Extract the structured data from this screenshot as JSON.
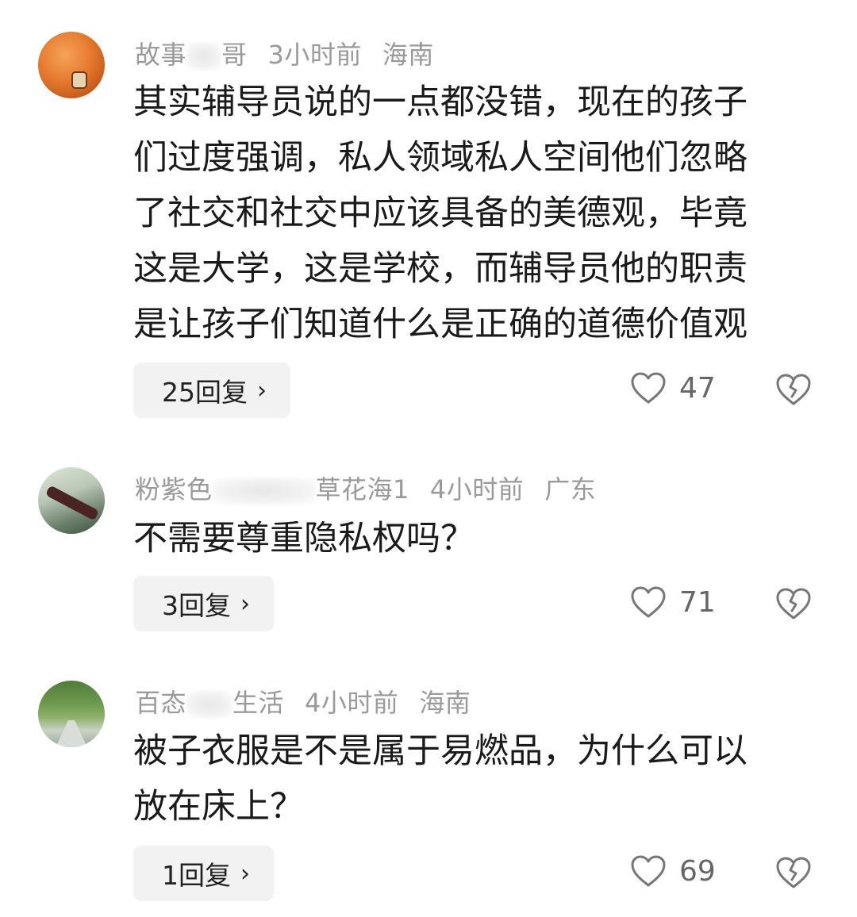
{
  "comments": [
    {
      "username_start": "故事",
      "username_end": "哥",
      "time": "3小时前",
      "location": "海南",
      "text": "其实辅导员说的一点都没错，现在的孩子们过度强调，私人领域私人空间他们忽略了社交和社交中应该具备的美德观，毕竟这是大学，这是学校，而辅导员他的职责是让孩子们知道什么是正确的道德价值观",
      "lines": [
        "其实辅导员说的一点都没错，现在的孩子",
        "们过度强调，私人领域私人空间他们忽略",
        "了社交和社交中应该具备的美德观，毕竟",
        "这是大学，这是学校，而辅导员他的职责",
        "是让孩子们知道什么是正确的道德价值观"
      ],
      "reply_label": "25回复",
      "likes": "47"
    },
    {
      "username_start": "粉紫色",
      "username_end": "草花海1",
      "time": "4小时前",
      "location": "广东",
      "lines": [
        "不需要尊重隐私权吗？"
      ],
      "reply_label": "3回复",
      "likes": "71"
    },
    {
      "username_start": "百态",
      "username_end": "生活",
      "time": "4小时前",
      "location": "海南",
      "lines": [
        "被子衣服是不是属于易燃品，为什么可以",
        "放在床上？"
      ],
      "reply_label": "1回复",
      "likes": "69"
    }
  ],
  "icons": {
    "reply_chevron": "chevron-right-icon",
    "like": "heart-icon",
    "dislike": "broken-heart-icon"
  },
  "colors": {
    "meta": "#9a9a9a",
    "text": "#1a1a1a",
    "pill_bg": "#f2f2f2",
    "icon": "#777777"
  }
}
